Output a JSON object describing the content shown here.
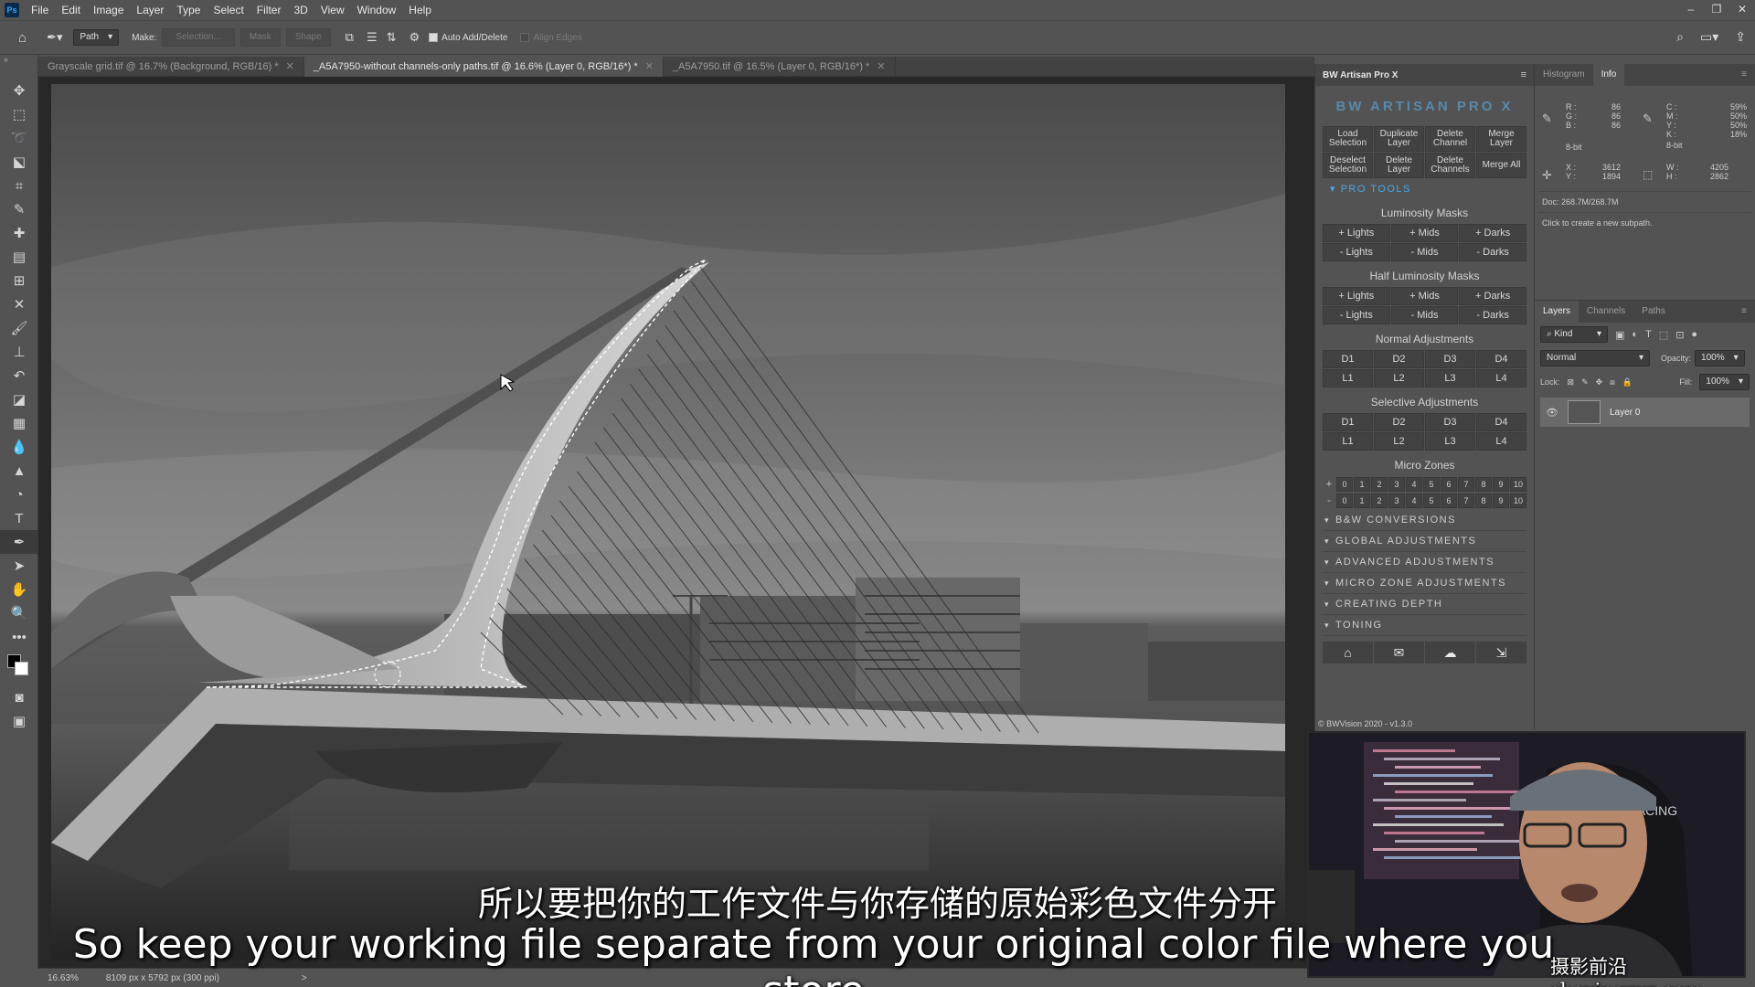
{
  "menubar": {
    "logo": "Ps",
    "items": [
      "File",
      "Edit",
      "Image",
      "Layer",
      "Type",
      "Select",
      "Filter",
      "3D",
      "View",
      "Window",
      "Help"
    ],
    "window_controls": [
      "–",
      "❐",
      "✕"
    ]
  },
  "options_bar": {
    "tool_mode": "Path",
    "make_label": "Make:",
    "selection_btn": "Selection...",
    "mask_btn": "Mask",
    "shape_btn": "Shape",
    "auto_add_delete": "Auto Add/Delete",
    "align_edges": "Align Edges"
  },
  "document_tabs": [
    {
      "label": "Grayscale grid.tif @ 16.7% (Background, RGB/16) *",
      "active": false
    },
    {
      "label": "_A5A7950-without channels-only paths.tif @ 16.6% (Layer 0, RGB/16*) *",
      "active": true
    },
    {
      "label": "_A5A7950.tif @ 16.5% (Layer 0, RGB/16*) *",
      "active": false
    }
  ],
  "status_bar": {
    "zoom": "16.63%",
    "doc_size": "8109 px x 5792 px (300 ppi)",
    "arrow": ">"
  },
  "artisan": {
    "title": "BW Artisan Pro X",
    "logo": "BW ARTISAN PRO X",
    "top_buttons": [
      "Load Selection",
      "Duplicate Layer",
      "Delete Channel",
      "Merge Layer",
      "Deselect Selection",
      "Delete Layer",
      "Delete Channels",
      "Merge All"
    ],
    "pro_tools": "PRO TOOLS",
    "luminosity_title": "Luminosity Masks",
    "luminosity": [
      "+ Lights",
      "+ Mids",
      "+ Darks",
      "- Lights",
      "- Mids",
      "- Darks"
    ],
    "half_title": "Half Luminosity Masks",
    "half": [
      "+ Lights",
      "+ Mids",
      "+ Darks",
      "- Lights",
      "- Mids",
      "- Darks"
    ],
    "normal_title": "Normal Adjustments",
    "normal": [
      "D1",
      "D2",
      "D3",
      "D4",
      "L1",
      "L2",
      "L3",
      "L4"
    ],
    "selective_title": "Selective Adjustments",
    "selective": [
      "D1",
      "D2",
      "D3",
      "D4",
      "L1",
      "L2",
      "L3",
      "L4"
    ],
    "micro_title": "Micro Zones",
    "micro_plus": "+",
    "micro_minus": "-",
    "zones": [
      "0",
      "1",
      "2",
      "3",
      "4",
      "5",
      "6",
      "7",
      "8",
      "9",
      "10"
    ],
    "sections": [
      "B&W CONVERSIONS",
      "GLOBAL ADJUSTMENTS",
      "ADVANCED ADJUSTMENTS",
      "MICRO ZONE ADJUSTMENTS",
      "CREATING DEPTH",
      "TONING"
    ],
    "version": "© BWVision 2020 - v1.3.0"
  },
  "info_panel": {
    "tabs": [
      "Histogram",
      "Info"
    ],
    "r_label": "R :",
    "r": "86",
    "g_label": "G :",
    "g": "86",
    "b_label": "B :",
    "b": "86",
    "bit_left": "8-bit",
    "c_label": "C :",
    "c": "59%",
    "m_label": "M :",
    "m": "50%",
    "y_label": "Y :",
    "y": "50%",
    "k_label": "K :",
    "k": "18%",
    "bit_right": "8-bit",
    "x_label": "X :",
    "x": "3612",
    "yc_label": "Y :",
    "yc": "1894",
    "w_label": "W :",
    "w": "4205",
    "h_label": "H :",
    "h": "2862",
    "doc": "Doc: 268.7M/268.7M",
    "hint": "Click to create a new subpath."
  },
  "layers_panel": {
    "tabs": [
      "Layers",
      "Channels",
      "Paths"
    ],
    "kind": "Kind",
    "blend_mode": "Normal",
    "opacity_label": "Opacity:",
    "opacity": "100%",
    "lock_label": "Lock:",
    "fill_label": "Fill:",
    "fill": "100%",
    "layer_name": "Layer 0"
  },
  "subtitles": {
    "chinese": "所以要把你的工作文件与你存储的原始彩色文件分开",
    "english": "So keep your working file separate from your original color file where you store"
  },
  "watermark": "摄影前沿 sheyingzyz.com",
  "webcam": {
    "sign_text": "AKRACING"
  }
}
